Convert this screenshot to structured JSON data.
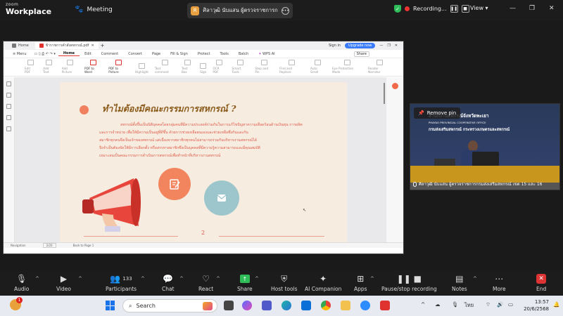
{
  "topbar": {
    "app_small": "zoom",
    "app_name": "Workplace",
    "meeting_label": "Meeting",
    "share_avatar": "R",
    "sharer_name": "ศิลาวุฒิ นับแสน ผู้ตรวจราชการกรมส่งเสริ",
    "recording_label": "Recording...",
    "view_label": "View"
  },
  "wps": {
    "tabs": [
      {
        "label": "Home"
      },
      {
        "label": "ข้าราชการคำสั่งสหกรณ์.pdf"
      }
    ],
    "sign_in": "Sign in",
    "upgrade": "Upgrade now",
    "menu": [
      "Menu",
      "Home",
      "Edit",
      "Comment",
      "Convert",
      "Page",
      "Fill & Sign",
      "Protect",
      "Tools",
      "Batch",
      "WPS AI"
    ],
    "share_label": "Share",
    "tools": [
      "Edit PDF",
      "Add Text",
      "Add Picture",
      "PDF to Word",
      "PDF to Picture",
      "Highlight",
      "Text comment",
      "Text Box",
      "Sign",
      "OCR PDF",
      "Smart Tools",
      "Step and Pin",
      "Find and Replace",
      "Auto Scroll",
      "Eye Protection Mode",
      "Reader Narrator"
    ],
    "status": {
      "navigation": "Navigation",
      "page_indicator": "2/20",
      "back": "Back to Page 1"
    }
  },
  "pdf": {
    "title": "ทำไมต้องมีคณะกรรมการสหกรณ์ ?",
    "lines": [
      "สหกรณ์ตั้งขึ้นเป็นนิติบุคคลโดยกลุ่มคนที่มีความประสงค์ร่วมกันในการแก้ไขปัญหาความเดือดร้อนด้านเงินทุน การผลิต",
      "และการจำหน่าย เพื่อให้มีความเป็นอยู่ที่ดีขึ้น ด้วยการช่วยเหลือตนเองและช่วยเหลือซึ่งกันและกัน",
      "สมาชิกทุกคนจึงเป็นเจ้าของสหกรณ์ แต่เนื่องจากสมาชิกทุกคนไม่สามารถร่วมกันบริหารงานสหกรณ์ได้",
      "จึงจำเป็นต้องจัดให้มีการเลือกตั้ง หรือสรรหาสมาชิกซึ่งเป็นบุคคลที่มีความรู้ความสามารถและมีคุณสมบัติ",
      "เหมาะสมเป็นคณะกรรมการดำเนินการสหกรณ์เพื่อทำหน้าที่บริหารงานสหกรณ์"
    ],
    "page_number": "2"
  },
  "video": {
    "remove_pin": "Remove pin",
    "banner_line1": "สำนักงานสหกรณ์จังหวัดพะเยา",
    "banner_line2": "PHAYAO PROVINCIAL COOPERATIVE OFFICE",
    "banner_line3": "กรมส่งเสริมสหกรณ์ กระทรวงเกษตรและสหกรณ์",
    "participant_name": "ศิลาวุฒิ นับแสน ผู้ตรวจราชการกรมส่งเสริมสหกรณ์ เขต 15 และ 16"
  },
  "controls": {
    "audio": "Audio",
    "video": "Video",
    "participants": "Participants",
    "participants_count": "133",
    "chat": "Chat",
    "react": "React",
    "share": "Share",
    "host_tools": "Host tools",
    "ai_companion": "AI Companion",
    "apps": "Apps",
    "pause_recording": "Pause/stop recording",
    "notes": "Notes",
    "more": "More",
    "end": "End"
  },
  "taskbar": {
    "search_placeholder": "Search",
    "notification_count": "1",
    "language": "ไทย",
    "time": "13:57",
    "date": "20/6/2568"
  },
  "colors": {
    "zoom_bg": "#1c1c1c",
    "share_green": "#2ebd59",
    "end_red": "#dd3333",
    "pdf_title": "#8a5a1a",
    "pdf_text": "#e05a4a",
    "pdf_bg": "#f6ecdf"
  }
}
